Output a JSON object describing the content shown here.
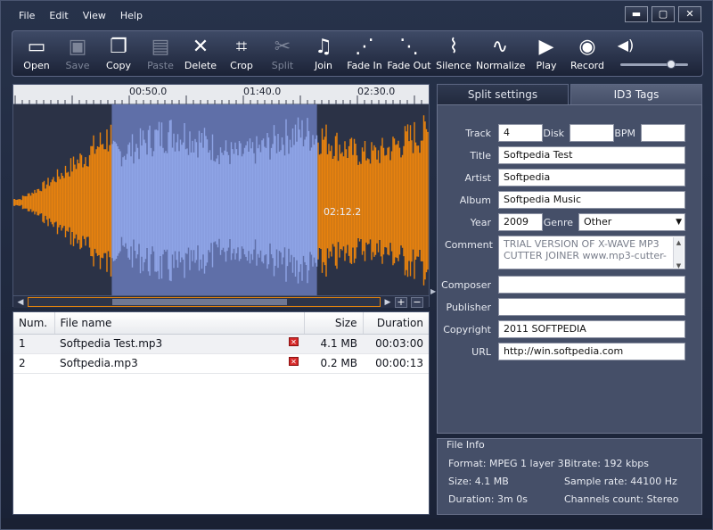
{
  "menu": [
    "File",
    "Edit",
    "View",
    "Help"
  ],
  "window_controls": {
    "minimize": "▬",
    "maximize": "▢",
    "close": "✕"
  },
  "toolbar": [
    {
      "label": "Open",
      "icon": "folder-icon",
      "glyph": "▭",
      "enabled": true
    },
    {
      "label": "Save",
      "icon": "floppy-icon",
      "glyph": "▣",
      "enabled": false
    },
    {
      "label": "Copy",
      "icon": "copy-icon",
      "glyph": "❐",
      "enabled": true
    },
    {
      "label": "Paste",
      "icon": "paste-icon",
      "glyph": "▤",
      "enabled": false
    },
    {
      "label": "Delete",
      "icon": "delete-icon",
      "glyph": "✕",
      "enabled": true
    },
    {
      "label": "Crop",
      "icon": "crop-icon",
      "glyph": "⌗",
      "enabled": true
    },
    {
      "label": "Split",
      "icon": "scissors-icon",
      "glyph": "✂",
      "enabled": false
    },
    {
      "label": "Join",
      "icon": "notes-icon",
      "glyph": "♫",
      "enabled": true
    },
    {
      "label": "Fade In",
      "icon": "fade-in-icon",
      "glyph": "⋰",
      "enabled": true
    },
    {
      "label": "Fade Out",
      "icon": "fade-out-icon",
      "glyph": "⋱",
      "enabled": true
    },
    {
      "label": "Silence",
      "icon": "silence-icon",
      "glyph": "⌇",
      "enabled": true
    },
    {
      "label": "Normalize",
      "icon": "normalize-icon",
      "glyph": "∿",
      "enabled": true
    },
    {
      "label": "Play",
      "icon": "play-icon",
      "glyph": "▶",
      "enabled": true
    },
    {
      "label": "Record",
      "icon": "record-icon",
      "glyph": "◉",
      "enabled": true
    }
  ],
  "volume": {
    "icon": "speaker-icon",
    "glyph": "◀)",
    "level": 0.75
  },
  "timeline": {
    "ticks": [
      "00:50.0",
      "01:40.0",
      "02:30.0"
    ]
  },
  "waveform": {
    "cursor_time": "02:12.2",
    "colors": {
      "wave": "#e8820e",
      "selection_bg": "#5f6fa8",
      "selection_wave": "#8ea4e6",
      "background": "#2b3246"
    },
    "selection": {
      "start_fraction": 0.237,
      "end_fraction": 0.731
    }
  },
  "scroll": {
    "left": "◀",
    "right": "▶",
    "zoom_in": "+",
    "zoom_out": "−"
  },
  "file_list": {
    "columns": [
      "Num.",
      "File name",
      "Size",
      "Duration"
    ],
    "rows": [
      {
        "num": "1",
        "name": "Softpedia Test.mp3",
        "size": "4.1 MB",
        "duration": "00:03:00"
      },
      {
        "num": "2",
        "name": "Softpedia.mp3",
        "size": "0.2 MB",
        "duration": "00:00:13"
      }
    ],
    "delete_glyph": "✕"
  },
  "tabs": {
    "split": "Split settings",
    "id3": "ID3 Tags"
  },
  "id3": {
    "track_label": "Track",
    "track": "4",
    "disk_label": "Disk",
    "disk": "",
    "bpm_label": "BPM",
    "bpm": "",
    "title_label": "Title",
    "title": "Softpedia Test",
    "artist_label": "Artist",
    "artist": "Softpedia",
    "album_label": "Album",
    "album": "Softpedia Music",
    "year_label": "Year",
    "year": "2009",
    "genre_label": "Genre",
    "genre": "Other",
    "comment_label": "Comment",
    "comment": "TRIAL VERSION OF X-WAVE MP3 CUTTER JOINER www.mp3-cutter-",
    "composer_label": "Composer",
    "composer": "",
    "publisher_label": "Publisher",
    "publisher": "",
    "copyright_label": "Copyright",
    "copyright": "2011 SOFTPEDIA",
    "url_label": "URL",
    "url": "http://win.softpedia.com"
  },
  "file_info": {
    "title": "File Info",
    "format": "Format: MPEG 1 layer 3",
    "bitrate": "Bitrate: 192 kbps",
    "size": "Size: 4.1 MB",
    "sample_rate": "Sample rate: 44100 Hz",
    "duration": "Duration: 3m 0s",
    "channels": "Channels count: Stereo"
  }
}
